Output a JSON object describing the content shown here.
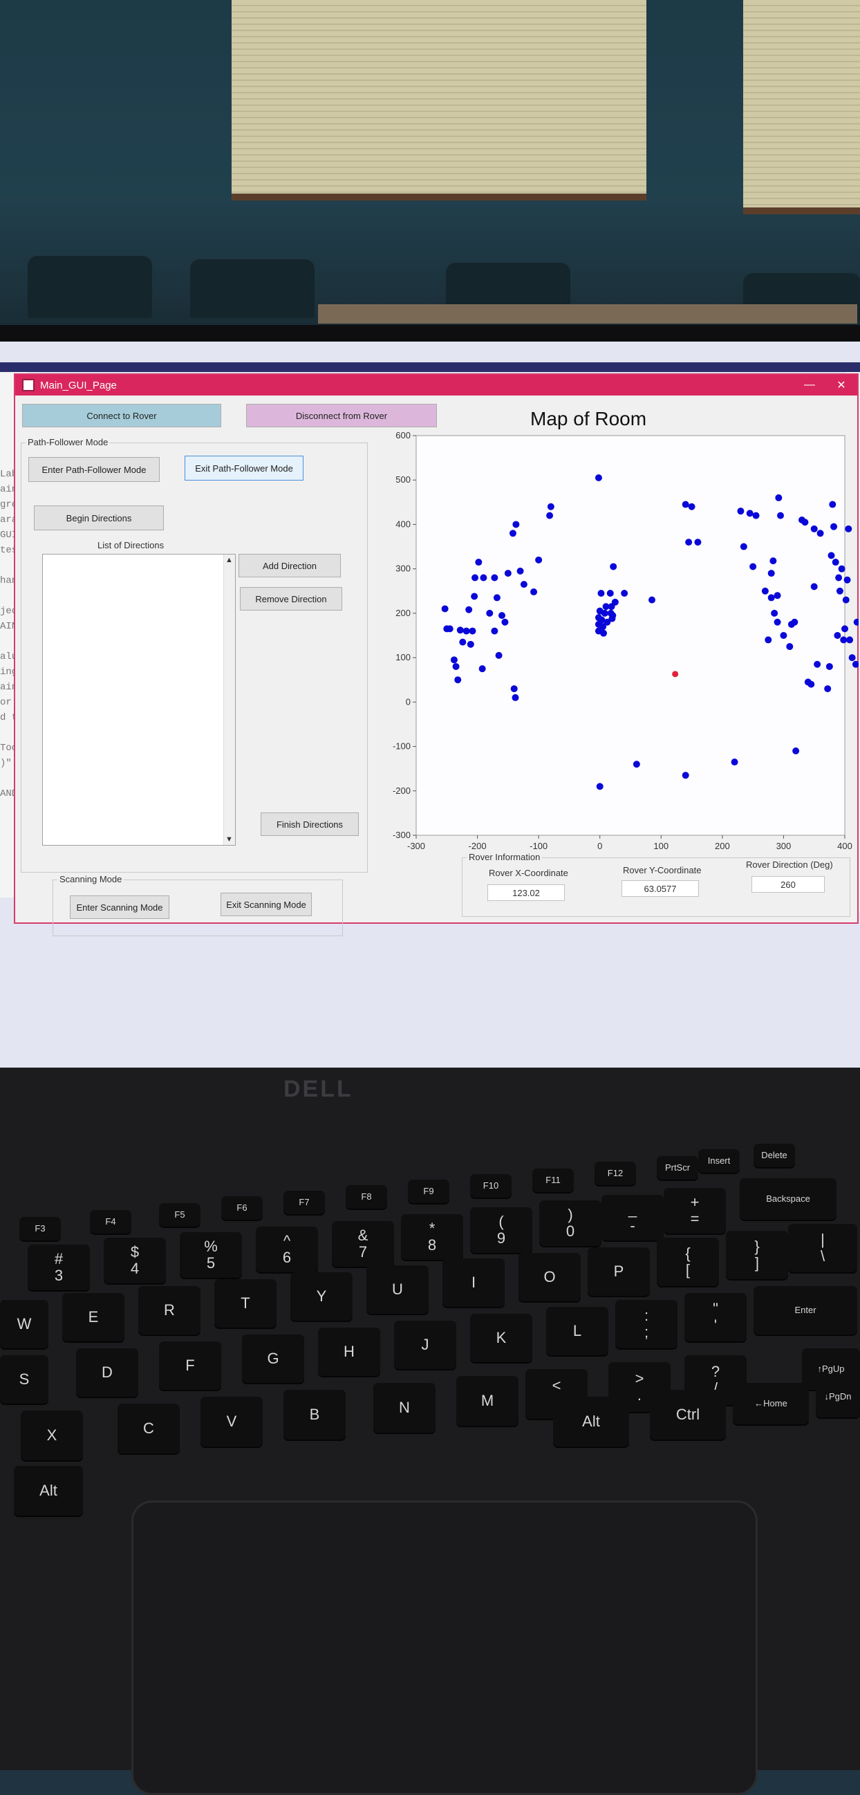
{
  "window": {
    "title": "Main_GUI_Page",
    "minimize": "—",
    "close": "✕"
  },
  "connection": {
    "connect_label": "Connect to Rover",
    "disconnect_label": "Disconnect from Rover"
  },
  "path_follower": {
    "group_label": "Path-Follower Mode",
    "enter_label": "Enter Path-Follower Mode",
    "exit_label": "Exit Path-Follower Mode",
    "begin_label": "Begin Directions",
    "list_label": "List of Directions",
    "add_label": "Add Direction",
    "remove_label": "Remove Direction",
    "finish_label": "Finish Directions"
  },
  "scanning": {
    "group_label": "Scanning Mode",
    "enter_label": "Enter Scanning Mode",
    "exit_label": "Exit Scanning Mode"
  },
  "rover_info": {
    "group_label": "Rover Information",
    "x_label": "Rover X-Coordinate",
    "x_value": "123.02",
    "y_label": "Rover Y-Coordinate",
    "y_value": "63.0577",
    "dir_label": "Rover Direction (Deg)",
    "dir_value": "260"
  },
  "ide_lines": [
    "Lab",
    "ain_G",
    "grees",
    "arar",
    "GUI",
    "tes",
    "",
    " han",
    "",
    "ject,",
    "AIN_G",
    "",
    "alue'",
    "ing fr",
    "ain_GU",
    "or inv",
    "d to M",
    "",
    " Tools",
    ")\".",
    "",
    "ANDLES"
  ],
  "keyboard": {
    "brand": "DELL",
    "keys": [
      "F3",
      "F4",
      "F5",
      "F6",
      "F7",
      "F8",
      "F9",
      "F10",
      "F11",
      "F12",
      "PrtScr",
      "Insert",
      "Delete",
      "#\n3",
      "$\n4",
      "%\n5",
      "^\n6",
      "&\n7",
      "*\n8",
      "(\n9",
      ")\n0",
      "_\n-",
      "+\n=",
      "Backspace",
      "W",
      "E",
      "R",
      "T",
      "Y",
      "U",
      "I",
      "O",
      "P",
      "{\n[",
      "}\n]",
      "|\n\\",
      "S",
      "D",
      "F",
      "G",
      "H",
      "J",
      "K",
      "L",
      ":\n;",
      "\"\n'",
      "Enter",
      "X",
      "C",
      "V",
      "B",
      "N",
      "M",
      "<\n,",
      ">\n.",
      "?\n/",
      "↑PgUp",
      "Alt",
      "Alt",
      "Ctrl",
      "←Home",
      "↓PgDn"
    ]
  },
  "chart_data": {
    "type": "scatter",
    "title": "Map of Room",
    "xlabel": "",
    "ylabel": "",
    "xlim": [
      -300,
      400
    ],
    "ylim": [
      -300,
      600
    ],
    "x_ticks": [
      -300,
      -200,
      -100,
      0,
      100,
      200,
      300,
      400
    ],
    "y_ticks": [
      -300,
      -200,
      -100,
      0,
      100,
      200,
      300,
      400,
      500,
      600
    ],
    "grid": false,
    "series": [
      {
        "color": "#0a08d8",
        "points": [
          [
            -253,
            210
          ],
          [
            -250,
            165
          ],
          [
            -245,
            165
          ],
          [
            -238,
            95
          ],
          [
            -235,
            80
          ],
          [
            -232,
            50
          ],
          [
            -228,
            162
          ],
          [
            -224,
            135
          ],
          [
            -218,
            160
          ],
          [
            -214,
            208
          ],
          [
            -211,
            130
          ],
          [
            -208,
            160
          ],
          [
            -205,
            238
          ],
          [
            -204,
            280
          ],
          [
            -198,
            315
          ],
          [
            -192,
            75
          ],
          [
            -190,
            280
          ],
          [
            -180,
            200
          ],
          [
            -172,
            160
          ],
          [
            -172,
            280
          ],
          [
            -168,
            235
          ],
          [
            -165,
            105
          ],
          [
            -160,
            195
          ],
          [
            -155,
            180
          ],
          [
            -150,
            290
          ],
          [
            -142,
            380
          ],
          [
            -140,
            30
          ],
          [
            -138,
            10
          ],
          [
            -137,
            400
          ],
          [
            -130,
            295
          ],
          [
            -124,
            265
          ],
          [
            -108,
            248
          ],
          [
            -100,
            320
          ],
          [
            -82,
            420
          ],
          [
            -80,
            440
          ],
          [
            -2,
            505
          ],
          [
            -2,
            190
          ],
          [
            -2,
            175
          ],
          [
            -2,
            160
          ],
          [
            0,
            205
          ],
          [
            2,
            245
          ],
          [
            3,
            185
          ],
          [
            5,
            170
          ],
          [
            6,
            155
          ],
          [
            8,
            200
          ],
          [
            10,
            215
          ],
          [
            12,
            180
          ],
          [
            17,
            245
          ],
          [
            18,
            200
          ],
          [
            19,
            215
          ],
          [
            20,
            188
          ],
          [
            21,
            195
          ],
          [
            22,
            305
          ],
          [
            25,
            225
          ],
          [
            40,
            245
          ],
          [
            85,
            230
          ],
          [
            0,
            -190
          ],
          [
            60,
            -140
          ],
          [
            140,
            -165
          ],
          [
            140,
            445
          ],
          [
            145,
            360
          ],
          [
            150,
            440
          ],
          [
            160,
            360
          ],
          [
            220,
            -135
          ],
          [
            230,
            430
          ],
          [
            235,
            350
          ],
          [
            245,
            425
          ],
          [
            250,
            305
          ],
          [
            255,
            420
          ],
          [
            270,
            250
          ],
          [
            275,
            140
          ],
          [
            280,
            235
          ],
          [
            280,
            290
          ],
          [
            283,
            318
          ],
          [
            285,
            200
          ],
          [
            290,
            240
          ],
          [
            290,
            180
          ],
          [
            292,
            460
          ],
          [
            295,
            420
          ],
          [
            300,
            150
          ],
          [
            310,
            125
          ],
          [
            313,
            175
          ],
          [
            318,
            180
          ],
          [
            320,
            -110
          ],
          [
            330,
            410
          ],
          [
            335,
            405
          ],
          [
            340,
            45
          ],
          [
            345,
            40
          ],
          [
            350,
            260
          ],
          [
            350,
            390
          ],
          [
            355,
            85
          ],
          [
            360,
            380
          ],
          [
            372,
            30
          ],
          [
            375,
            80
          ],
          [
            378,
            330
          ],
          [
            380,
            445
          ],
          [
            382,
            395
          ],
          [
            385,
            315
          ],
          [
            388,
            150
          ],
          [
            390,
            280
          ],
          [
            392,
            250
          ],
          [
            395,
            300
          ],
          [
            398,
            140
          ],
          [
            400,
            165
          ],
          [
            402,
            230
          ],
          [
            404,
            275
          ],
          [
            406,
            390
          ],
          [
            408,
            140
          ],
          [
            412,
            100
          ],
          [
            418,
            85
          ],
          [
            420,
            180
          ]
        ]
      },
      {
        "color": "#e0203a",
        "points": [
          [
            123.02,
            63.0577
          ]
        ]
      }
    ]
  }
}
